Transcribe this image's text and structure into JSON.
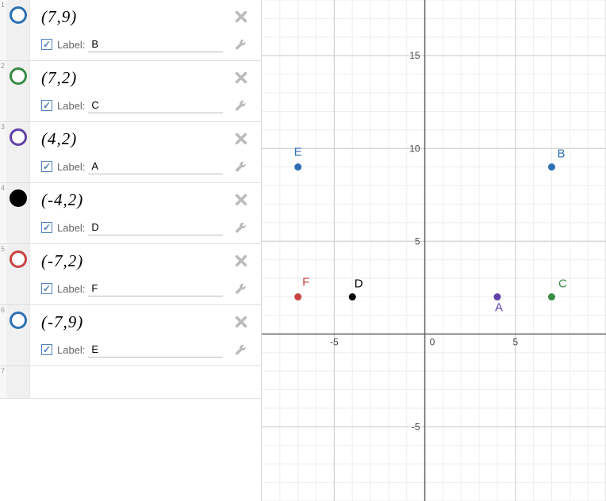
{
  "sidebar": {
    "label_prefix": "Label:",
    "rows": [
      {
        "num": "1",
        "expr": "(7,9)",
        "label": "B",
        "color": "#2d70b3",
        "filled": false
      },
      {
        "num": "2",
        "expr": "(7,2)",
        "label": "C",
        "color": "#388c46",
        "filled": false
      },
      {
        "num": "3",
        "expr": "(4,2)",
        "label": "A",
        "color": "#6042a6",
        "filled": false
      },
      {
        "num": "4",
        "expr": "(-4,2)",
        "label": "D",
        "color": "#000000",
        "filled": true
      },
      {
        "num": "5",
        "expr": "(-7,2)",
        "label": "F",
        "color": "#c74440",
        "filled": false
      },
      {
        "num": "6",
        "expr": "(-7,9)",
        "label": "E",
        "color": "#2d70b3",
        "filled": false
      }
    ],
    "empty_row_num": "7"
  },
  "chart_data": {
    "type": "scatter",
    "xlim": [
      -9,
      10
    ],
    "ylim": [
      -9,
      18
    ],
    "x_ticks": [
      -5,
      0,
      5
    ],
    "y_ticks": [
      -5,
      5,
      10,
      15
    ],
    "points": [
      {
        "x": 7,
        "y": 9,
        "label": "B",
        "color": "#2d70b3",
        "label_dx": 12,
        "label_dy": -12
      },
      {
        "x": 7,
        "y": 2,
        "label": "C",
        "color": "#388c46",
        "label_dx": 14,
        "label_dy": -12
      },
      {
        "x": 4,
        "y": 2,
        "label": "A",
        "color": "#6042a6",
        "label_dx": 2,
        "label_dy": 18
      },
      {
        "x": -4,
        "y": 2,
        "label": "D",
        "color": "#000000",
        "label_dx": 8,
        "label_dy": -12
      },
      {
        "x": -7,
        "y": 2,
        "label": "F",
        "color": "#c74440",
        "label_dx": 10,
        "label_dy": -14
      },
      {
        "x": -7,
        "y": 9,
        "label": "E",
        "color": "#2d70b3",
        "label_dx": 0,
        "label_dy": -14
      }
    ]
  }
}
